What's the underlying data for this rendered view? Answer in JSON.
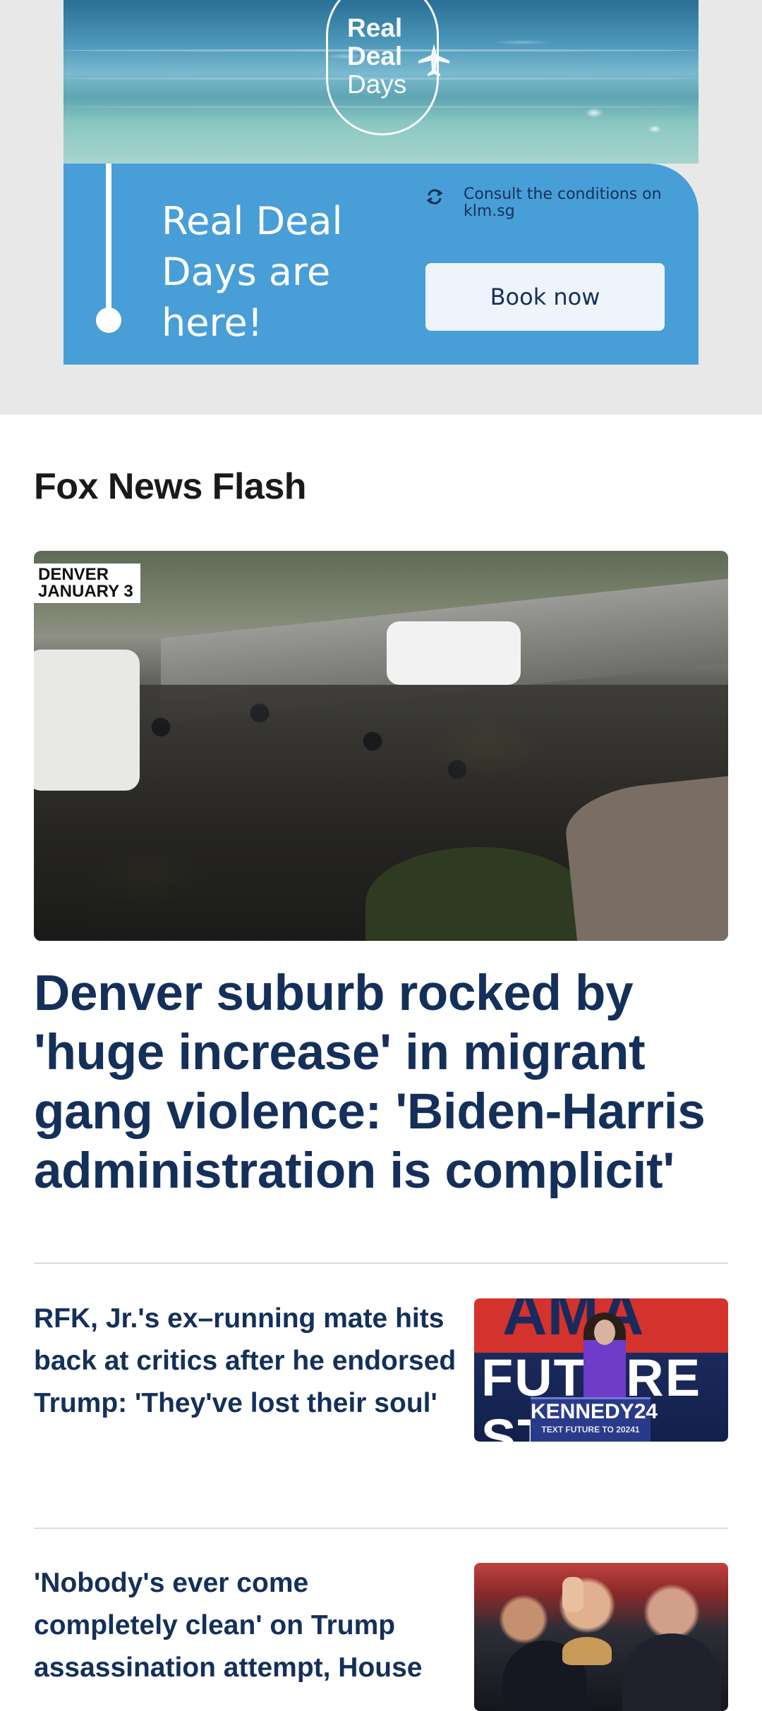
{
  "ad": {
    "logo_line1": "Real",
    "logo_line2": "Deal",
    "logo_line3": "Days",
    "headline": "Real Deal Days are here!",
    "conditions": "Consult the conditions on klm.sg",
    "cta": "Book now",
    "icons": [
      "refresh-icon",
      "plane-icon"
    ],
    "colors": {
      "panel": "#489ed6",
      "button": "#eef4fb",
      "button_text": "#17305a"
    }
  },
  "section": {
    "title": "Fox News Flash"
  },
  "hero": {
    "image_tag": "DENVER\nJANUARY 3",
    "headline": "Denver suburb rocked by 'huge increase' in migrant gang violence: 'Biden-Harris administration is complicit'"
  },
  "stories": [
    {
      "title": "RFK, Jr.'s ex–running mate hits back at critics after he endorsed Trump: 'They've lost their soul'",
      "thumb_sign_top": "AMA",
      "thumb_sign_bottom": "FUTURE STAR",
      "thumb_podium": "KENNEDY24",
      "thumb_podium_sub": "TEXT FUTURE TO 20241"
    },
    {
      "title": "'Nobody's ever come completely clean' on Trump assassination attempt, House"
    }
  ],
  "colors": {
    "headline": "#14305a",
    "section_title": "#1a1a1a",
    "divider": "#dcdcdc"
  }
}
